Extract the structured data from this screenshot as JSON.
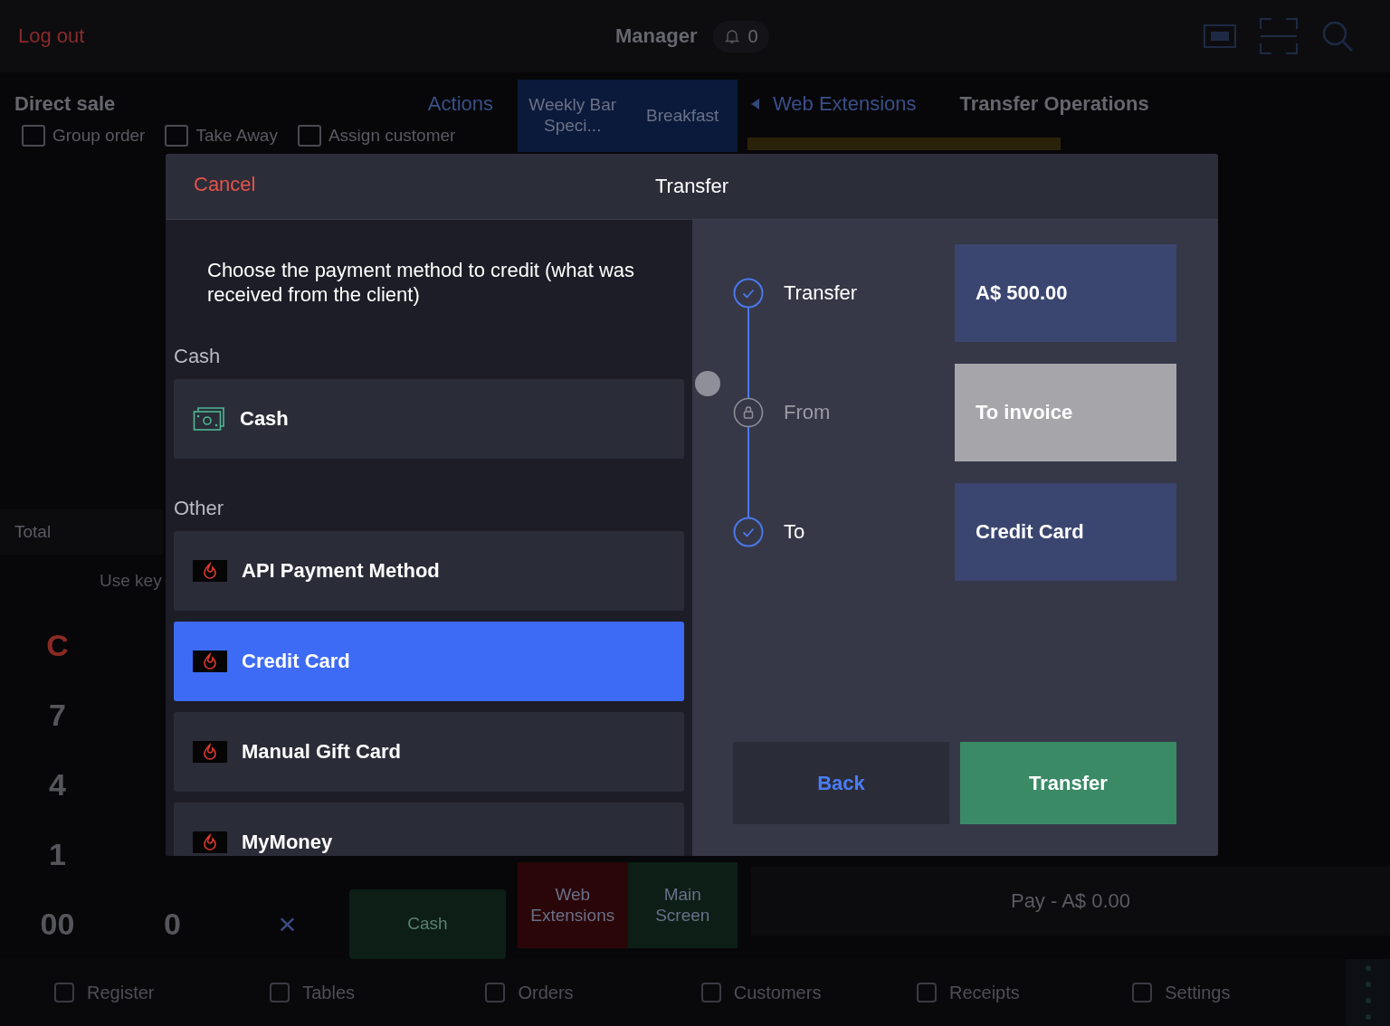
{
  "header": {
    "logout": "Log out",
    "user": "Manager",
    "notifications": "0"
  },
  "order_panel": {
    "title": "Direct sale",
    "actions": "Actions",
    "toolbar": [
      {
        "label": "Group order"
      },
      {
        "label": "Take Away"
      },
      {
        "label": "Assign customer"
      }
    ],
    "total_label": "Total",
    "hint": "Use key",
    "keypad_rows": [
      [
        "C"
      ],
      [
        "7"
      ],
      [
        "4"
      ],
      [
        "1"
      ],
      [
        "00",
        "0",
        "×"
      ]
    ]
  },
  "quick_tiles": {
    "top": [
      {
        "label": "Weekly Bar Speci...",
        "color": "#0b1a3a"
      },
      {
        "label": "Breakfast",
        "color": "#0b1a3a"
      }
    ],
    "bottom": [
      {
        "label": "Cash",
        "color": "#0c1e16"
      },
      {
        "label": "Web Extensions",
        "color": "#2a0608"
      },
      {
        "label": "Main Screen",
        "color": "#0c1e16"
      }
    ]
  },
  "right_panel": {
    "back_label": "Web Extensions",
    "title": "Transfer Operations",
    "pay_button": "Pay - A$ 0.00"
  },
  "tab_bar": [
    {
      "label": "Register"
    },
    {
      "label": "Tables"
    },
    {
      "label": "Orders"
    },
    {
      "label": "Customers"
    },
    {
      "label": "Receipts"
    },
    {
      "label": "Settings"
    }
  ],
  "dialog": {
    "cancel": "Cancel",
    "title": "Transfer",
    "instruction": "Choose the payment method to credit (what was received from the client)",
    "groups": [
      {
        "heading": "Cash",
        "methods": [
          {
            "label": "Cash",
            "kind": "cash",
            "selected": false
          }
        ]
      },
      {
        "heading": "Other",
        "methods": [
          {
            "label": "API Payment Method",
            "kind": "app",
            "selected": false
          },
          {
            "label": "Credit Card",
            "kind": "app",
            "selected": true
          },
          {
            "label": "Manual Gift Card",
            "kind": "app",
            "selected": false
          },
          {
            "label": "MyMoney",
            "kind": "app",
            "selected": false
          }
        ]
      }
    ],
    "steps": [
      {
        "label": "Transfer",
        "checked": true,
        "value": "A$ 500.00",
        "disabled": false
      },
      {
        "label": "From",
        "checked": false,
        "value": "To invoice",
        "disabled": true
      },
      {
        "label": "To",
        "checked": true,
        "value": "Credit Card",
        "disabled": false
      }
    ],
    "back": "Back",
    "confirm": "Transfer"
  }
}
